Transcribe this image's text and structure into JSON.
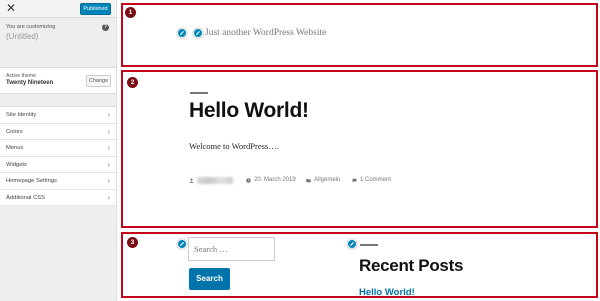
{
  "customizer": {
    "close_label": "✕",
    "publish_label": "Published",
    "you_are_customizing": "You are customizing",
    "site_name": "(Untitled)",
    "help_icon": "question-icon",
    "active_theme_label": "Active theme",
    "active_theme_name": "Twenty Nineteen",
    "change_label": "Change",
    "panels": [
      {
        "label": "Site Identity"
      },
      {
        "label": "Colors"
      },
      {
        "label": "Menus"
      },
      {
        "label": "Widgets"
      },
      {
        "label": "Homepage Settings"
      },
      {
        "label": "Additional CSS"
      }
    ]
  },
  "preview": {
    "badges": [
      "1",
      "2",
      "3"
    ],
    "site_description": "Just another WordPress Website",
    "post": {
      "title": "Hello World!",
      "content": "Welcome to WordPress….",
      "date": "20. March 2019",
      "category": "Allgemein",
      "comments": "1 Comment"
    },
    "search": {
      "placeholder": "Search …",
      "button_label": "Search"
    },
    "recent_posts": {
      "title": "Recent Posts",
      "items": [
        "Hello World!"
      ]
    }
  },
  "colors": {
    "accent": "#0085ba",
    "link": "#0073aa",
    "highlight_frame": "#c5051b",
    "badge": "#7a0a14"
  }
}
